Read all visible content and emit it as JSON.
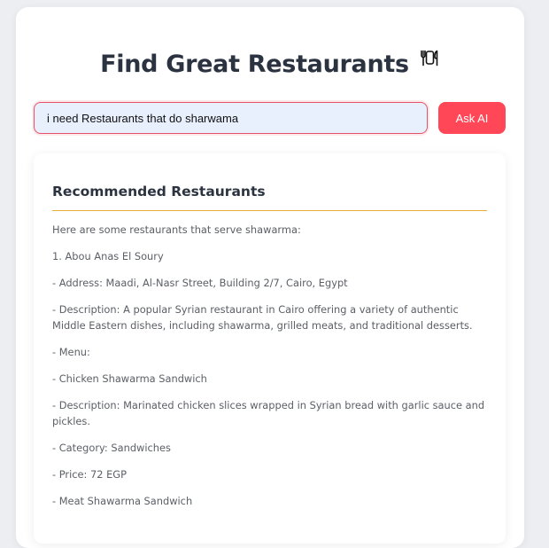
{
  "header": {
    "title": "Find Great Restaurants",
    "title_icon": "plate-cutlery-icon"
  },
  "search": {
    "value": "i need Restaurants that do sharwama",
    "button_label": "Ask AI"
  },
  "result": {
    "heading": "Recommended Restaurants",
    "paragraphs": [
      "Here are some restaurants that serve shawarma:",
      "1. Abou Anas El Soury",
      "- Address: Maadi, Al-Nasr Street, Building 2/7, Cairo, Egypt",
      "- Description: A popular Syrian restaurant in Cairo offering a variety of authentic Middle Eastern dishes, including shawarma, grilled meats, and traditional desserts.",
      "- Menu:",
      "- Chicken Shawarma Sandwich",
      "- Description: Marinated chicken slices wrapped in Syrian bread with garlic sauce and pickles.",
      "- Category: Sandwiches",
      "- Price: 72 EGP",
      "- Meat Shawarma Sandwich"
    ]
  },
  "colors": {
    "accent": "#ff4757",
    "divider": "#e8ad3a",
    "input_bg": "#e8f0fe",
    "text_dark": "#2c3340",
    "text_body": "#5b5f66"
  }
}
